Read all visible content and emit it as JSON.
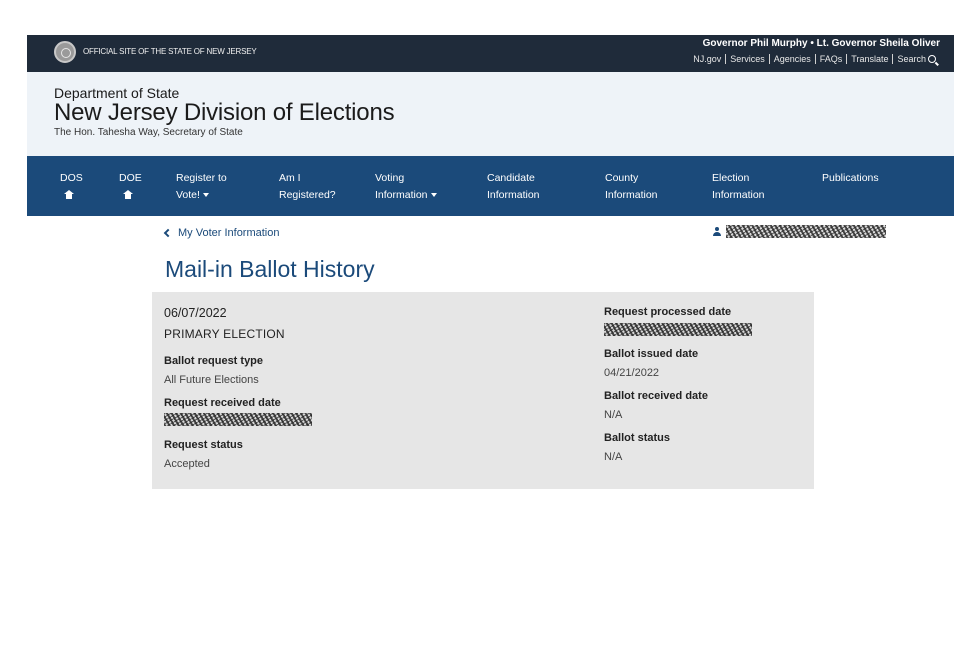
{
  "topbar": {
    "official_text": "Official Site of the State of New Jersey",
    "governor_line": "Governor Phil Murphy • Lt. Governor Sheila Oliver",
    "links": [
      "NJ.gov",
      "Services",
      "Agencies",
      "FAQs",
      "Translate",
      "Search"
    ]
  },
  "header": {
    "department": "Department of State",
    "division": "New Jersey Division of Elections",
    "secretary": "The Hon. Tahesha Way, Secretary of State"
  },
  "nav": {
    "items": [
      {
        "line1": "DOS",
        "line2": "",
        "icon": "home-icon"
      },
      {
        "line1": "DOE",
        "line2": "",
        "icon": "home-icon"
      },
      {
        "line1": "Register to",
        "line2": "Vote!",
        "dropdown": true
      },
      {
        "line1": "Am I",
        "line2": "Registered?"
      },
      {
        "line1": "Voting",
        "line2": "Information",
        "dropdown": true
      },
      {
        "line1": "Candidate",
        "line2": "Information"
      },
      {
        "line1": "County",
        "line2": "Information"
      },
      {
        "line1": "Election",
        "line2": "Information"
      },
      {
        "line1": "Publications",
        "line2": ""
      }
    ]
  },
  "breadcrumb": {
    "back_label": "My Voter Information"
  },
  "page": {
    "title": "Mail-in Ballot History"
  },
  "ballot": {
    "date": "06/07/2022",
    "election": "PRIMARY ELECTION",
    "request_type_label": "Ballot request type",
    "request_type_value": "All Future Elections",
    "request_received_label": "Request received date",
    "request_status_label": "Request status",
    "request_status_value": "Accepted",
    "request_processed_label": "Request processed date",
    "ballot_issued_label": "Ballot issued date",
    "ballot_issued_value": "04/21/2022",
    "ballot_received_label": "Ballot received date",
    "ballot_received_value": "N/A",
    "ballot_status_label": "Ballot status",
    "ballot_status_value": "N/A"
  }
}
